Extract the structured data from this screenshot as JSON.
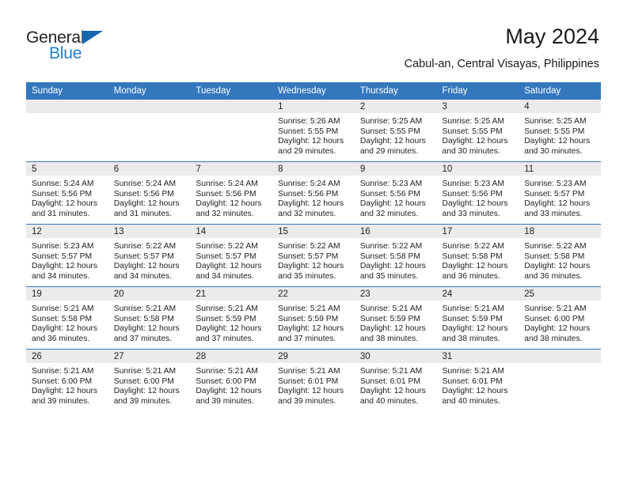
{
  "logo": {
    "word1": "General",
    "word2": "Blue",
    "triangle_color": "#1566b0",
    "word2_color": "#1f7fd0",
    "icon": "general-blue-logo"
  },
  "header": {
    "title": "May 2024",
    "subtitle": "Cabul-an, Central Visayas, Philippines"
  },
  "theme": {
    "header_bg": "#3477bd",
    "header_text": "#ffffff",
    "daystrip_bg": "#ebebeb",
    "cell_bg": "#ffffff",
    "rule_color": "#3477bd"
  },
  "calendar": {
    "weekday_headers": [
      "Sunday",
      "Monday",
      "Tuesday",
      "Wednesday",
      "Thursday",
      "Friday",
      "Saturday"
    ],
    "weeks": [
      [
        {
          "day": "",
          "blank": true,
          "sunrise": "",
          "sunset": "",
          "daylight1": "",
          "daylight2": ""
        },
        {
          "day": "",
          "blank": true,
          "sunrise": "",
          "sunset": "",
          "daylight1": "",
          "daylight2": ""
        },
        {
          "day": "",
          "blank": true,
          "sunrise": "",
          "sunset": "",
          "daylight1": "",
          "daylight2": ""
        },
        {
          "day": "1",
          "blank": false,
          "sunrise": "Sunrise: 5:26 AM",
          "sunset": "Sunset: 5:55 PM",
          "daylight1": "Daylight: 12 hours",
          "daylight2": "and 29 minutes."
        },
        {
          "day": "2",
          "blank": false,
          "sunrise": "Sunrise: 5:25 AM",
          "sunset": "Sunset: 5:55 PM",
          "daylight1": "Daylight: 12 hours",
          "daylight2": "and 29 minutes."
        },
        {
          "day": "3",
          "blank": false,
          "sunrise": "Sunrise: 5:25 AM",
          "sunset": "Sunset: 5:55 PM",
          "daylight1": "Daylight: 12 hours",
          "daylight2": "and 30 minutes."
        },
        {
          "day": "4",
          "blank": false,
          "sunrise": "Sunrise: 5:25 AM",
          "sunset": "Sunset: 5:55 PM",
          "daylight1": "Daylight: 12 hours",
          "daylight2": "and 30 minutes."
        }
      ],
      [
        {
          "day": "5",
          "blank": false,
          "sunrise": "Sunrise: 5:24 AM",
          "sunset": "Sunset: 5:56 PM",
          "daylight1": "Daylight: 12 hours",
          "daylight2": "and 31 minutes."
        },
        {
          "day": "6",
          "blank": false,
          "sunrise": "Sunrise: 5:24 AM",
          "sunset": "Sunset: 5:56 PM",
          "daylight1": "Daylight: 12 hours",
          "daylight2": "and 31 minutes."
        },
        {
          "day": "7",
          "blank": false,
          "sunrise": "Sunrise: 5:24 AM",
          "sunset": "Sunset: 5:56 PM",
          "daylight1": "Daylight: 12 hours",
          "daylight2": "and 32 minutes."
        },
        {
          "day": "8",
          "blank": false,
          "sunrise": "Sunrise: 5:24 AM",
          "sunset": "Sunset: 5:56 PM",
          "daylight1": "Daylight: 12 hours",
          "daylight2": "and 32 minutes."
        },
        {
          "day": "9",
          "blank": false,
          "sunrise": "Sunrise: 5:23 AM",
          "sunset": "Sunset: 5:56 PM",
          "daylight1": "Daylight: 12 hours",
          "daylight2": "and 32 minutes."
        },
        {
          "day": "10",
          "blank": false,
          "sunrise": "Sunrise: 5:23 AM",
          "sunset": "Sunset: 5:56 PM",
          "daylight1": "Daylight: 12 hours",
          "daylight2": "and 33 minutes."
        },
        {
          "day": "11",
          "blank": false,
          "sunrise": "Sunrise: 5:23 AM",
          "sunset": "Sunset: 5:57 PM",
          "daylight1": "Daylight: 12 hours",
          "daylight2": "and 33 minutes."
        }
      ],
      [
        {
          "day": "12",
          "blank": false,
          "sunrise": "Sunrise: 5:23 AM",
          "sunset": "Sunset: 5:57 PM",
          "daylight1": "Daylight: 12 hours",
          "daylight2": "and 34 minutes."
        },
        {
          "day": "13",
          "blank": false,
          "sunrise": "Sunrise: 5:22 AM",
          "sunset": "Sunset: 5:57 PM",
          "daylight1": "Daylight: 12 hours",
          "daylight2": "and 34 minutes."
        },
        {
          "day": "14",
          "blank": false,
          "sunrise": "Sunrise: 5:22 AM",
          "sunset": "Sunset: 5:57 PM",
          "daylight1": "Daylight: 12 hours",
          "daylight2": "and 34 minutes."
        },
        {
          "day": "15",
          "blank": false,
          "sunrise": "Sunrise: 5:22 AM",
          "sunset": "Sunset: 5:57 PM",
          "daylight1": "Daylight: 12 hours",
          "daylight2": "and 35 minutes."
        },
        {
          "day": "16",
          "blank": false,
          "sunrise": "Sunrise: 5:22 AM",
          "sunset": "Sunset: 5:58 PM",
          "daylight1": "Daylight: 12 hours",
          "daylight2": "and 35 minutes."
        },
        {
          "day": "17",
          "blank": false,
          "sunrise": "Sunrise: 5:22 AM",
          "sunset": "Sunset: 5:58 PM",
          "daylight1": "Daylight: 12 hours",
          "daylight2": "and 36 minutes."
        },
        {
          "day": "18",
          "blank": false,
          "sunrise": "Sunrise: 5:22 AM",
          "sunset": "Sunset: 5:58 PM",
          "daylight1": "Daylight: 12 hours",
          "daylight2": "and 36 minutes."
        }
      ],
      [
        {
          "day": "19",
          "blank": false,
          "sunrise": "Sunrise: 5:21 AM",
          "sunset": "Sunset: 5:58 PM",
          "daylight1": "Daylight: 12 hours",
          "daylight2": "and 36 minutes."
        },
        {
          "day": "20",
          "blank": false,
          "sunrise": "Sunrise: 5:21 AM",
          "sunset": "Sunset: 5:58 PM",
          "daylight1": "Daylight: 12 hours",
          "daylight2": "and 37 minutes."
        },
        {
          "day": "21",
          "blank": false,
          "sunrise": "Sunrise: 5:21 AM",
          "sunset": "Sunset: 5:59 PM",
          "daylight1": "Daylight: 12 hours",
          "daylight2": "and 37 minutes."
        },
        {
          "day": "22",
          "blank": false,
          "sunrise": "Sunrise: 5:21 AM",
          "sunset": "Sunset: 5:59 PM",
          "daylight1": "Daylight: 12 hours",
          "daylight2": "and 37 minutes."
        },
        {
          "day": "23",
          "blank": false,
          "sunrise": "Sunrise: 5:21 AM",
          "sunset": "Sunset: 5:59 PM",
          "daylight1": "Daylight: 12 hours",
          "daylight2": "and 38 minutes."
        },
        {
          "day": "24",
          "blank": false,
          "sunrise": "Sunrise: 5:21 AM",
          "sunset": "Sunset: 5:59 PM",
          "daylight1": "Daylight: 12 hours",
          "daylight2": "and 38 minutes."
        },
        {
          "day": "25",
          "blank": false,
          "sunrise": "Sunrise: 5:21 AM",
          "sunset": "Sunset: 6:00 PM",
          "daylight1": "Daylight: 12 hours",
          "daylight2": "and 38 minutes."
        }
      ],
      [
        {
          "day": "26",
          "blank": false,
          "sunrise": "Sunrise: 5:21 AM",
          "sunset": "Sunset: 6:00 PM",
          "daylight1": "Daylight: 12 hours",
          "daylight2": "and 39 minutes."
        },
        {
          "day": "27",
          "blank": false,
          "sunrise": "Sunrise: 5:21 AM",
          "sunset": "Sunset: 6:00 PM",
          "daylight1": "Daylight: 12 hours",
          "daylight2": "and 39 minutes."
        },
        {
          "day": "28",
          "blank": false,
          "sunrise": "Sunrise: 5:21 AM",
          "sunset": "Sunset: 6:00 PM",
          "daylight1": "Daylight: 12 hours",
          "daylight2": "and 39 minutes."
        },
        {
          "day": "29",
          "blank": false,
          "sunrise": "Sunrise: 5:21 AM",
          "sunset": "Sunset: 6:01 PM",
          "daylight1": "Daylight: 12 hours",
          "daylight2": "and 39 minutes."
        },
        {
          "day": "30",
          "blank": false,
          "sunrise": "Sunrise: 5:21 AM",
          "sunset": "Sunset: 6:01 PM",
          "daylight1": "Daylight: 12 hours",
          "daylight2": "and 40 minutes."
        },
        {
          "day": "31",
          "blank": false,
          "sunrise": "Sunrise: 5:21 AM",
          "sunset": "Sunset: 6:01 PM",
          "daylight1": "Daylight: 12 hours",
          "daylight2": "and 40 minutes."
        },
        {
          "day": "",
          "blank": true,
          "sunrise": "",
          "sunset": "",
          "daylight1": "",
          "daylight2": ""
        }
      ]
    ]
  }
}
